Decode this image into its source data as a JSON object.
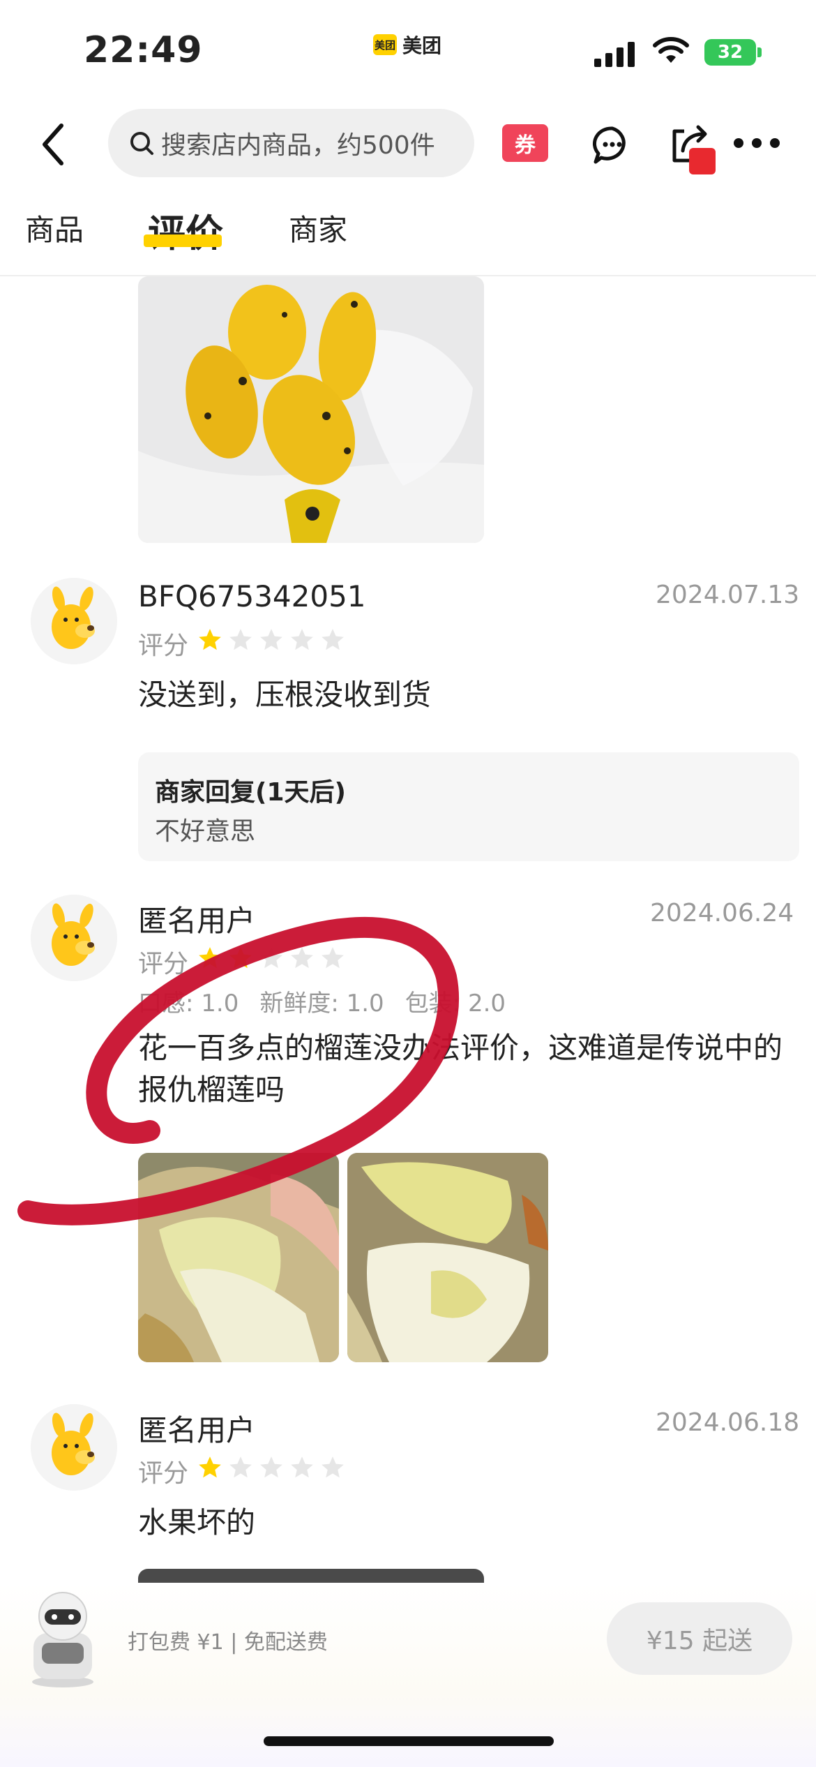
{
  "status_bar": {
    "time": "22:49",
    "app_name": "美团",
    "app_logo_text": "美团",
    "battery": "32"
  },
  "header": {
    "search_placeholder": "搜索店内商品，约500件",
    "coupon_label": "券"
  },
  "tabs": [
    {
      "label": "商品"
    },
    {
      "label": "评价",
      "active": true
    },
    {
      "label": "商家"
    }
  ],
  "reviews": [
    {
      "user": "BFQ675342051",
      "date": "2024.07.13",
      "rating_label": "评分",
      "stars": 1,
      "text": "没送到，压根没收到货",
      "reply": {
        "title": "商家回复(1天后)",
        "text": "不好意思"
      }
    },
    {
      "user": "匿名用户",
      "date": "2024.06.24",
      "rating_label": "评分",
      "stars": 2,
      "subscores": [
        "口感: 1.0",
        "新鲜度: 1.0",
        "包装: 2.0"
      ],
      "text_line1": "花一百多点的榴莲没办法评价，这难道是传说中的",
      "text_line2": "报仇榴莲吗"
    },
    {
      "user": "匿名用户",
      "date": "2024.06.18",
      "rating_label": "评分",
      "stars": 1,
      "text": "水果坏的"
    }
  ],
  "bottom_bar": {
    "fees": "打包费 ¥1 | 免配送费",
    "min_order": "¥15 起送"
  },
  "colors": {
    "accent": "#ffd100",
    "star_filled": "#ffd100",
    "star_empty": "#e6e6e6",
    "annotation": "#c8102e"
  }
}
